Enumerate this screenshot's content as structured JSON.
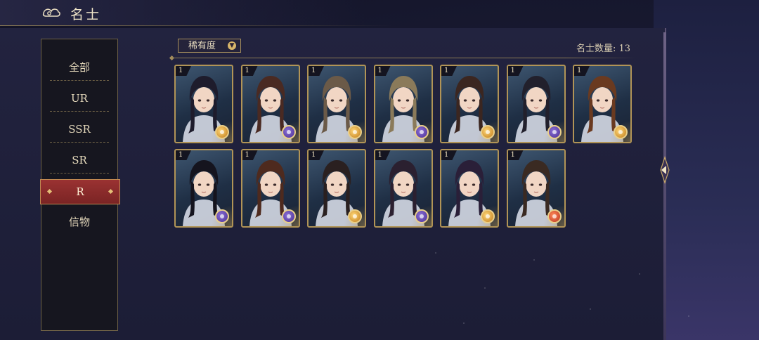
{
  "header": {
    "title": "名士",
    "logo_icon": "cloud-swirl-icon"
  },
  "filter": {
    "label": "稀有度",
    "chevron_icon": "chevron-down-icon"
  },
  "count_text": "名士数量: 13",
  "sidebar": {
    "items": [
      {
        "label": "全部",
        "active": false
      },
      {
        "label": "UR",
        "active": false
      },
      {
        "label": "SSR",
        "active": false
      },
      {
        "label": "SR",
        "active": false
      },
      {
        "label": "R",
        "active": true
      },
      {
        "label": "信物",
        "active": false
      }
    ]
  },
  "cards": [
    {
      "level": "1",
      "character": "dark-haired man with cat ears",
      "badge": "gold"
    },
    {
      "level": "1",
      "character": "girl with red flower hairpins",
      "badge": "purple"
    },
    {
      "level": "1",
      "character": "girl with lavender hair flowers",
      "badge": "gold"
    },
    {
      "level": "1",
      "character": "green-eyed child",
      "badge": "purple"
    },
    {
      "level": "1",
      "character": "brown-haired man",
      "badge": "gold"
    },
    {
      "level": "1",
      "character": "long-haired man with choker",
      "badge": "purple"
    },
    {
      "level": "1",
      "character": "man with scarf",
      "badge": "gold"
    },
    {
      "level": "1",
      "character": "long black-haired man",
      "badge": "purple"
    },
    {
      "level": "1",
      "character": "young man with red headband",
      "badge": "purple"
    },
    {
      "level": "1",
      "character": "bearded man",
      "badge": "gold"
    },
    {
      "level": "1",
      "character": "man with forehead mark",
      "badge": "purple"
    },
    {
      "level": "1",
      "character": "long purple-haired man",
      "badge": "gold"
    },
    {
      "level": "1",
      "character": "man with monocle",
      "badge": "red"
    }
  ],
  "colors": {
    "accent_gold": "#b19456",
    "active_tab": "#9a3232",
    "badge_purple": "#4a2f94",
    "badge_gold": "#c07a18",
    "badge_red": "#b8321e"
  }
}
